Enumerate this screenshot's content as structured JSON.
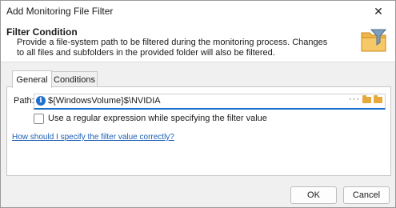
{
  "window": {
    "title": "Add Monitoring File Filter"
  },
  "header": {
    "title": "Filter Condition",
    "description": "Provide a file-system path to be filtered during the monitoring process. Changes to all files and subfolders in the provided folder will also be filtered."
  },
  "tabs": [
    {
      "label": "General"
    },
    {
      "label": "Conditions"
    }
  ],
  "path": {
    "label": "Path:",
    "value": "${WindowsVolume}$\\NVIDIA",
    "more_glyph": "···"
  },
  "regex_option": {
    "label": "Use a regular expression while specifying the filter value",
    "checked": false
  },
  "help_link": "How should I specify the filter value correctly?",
  "buttons": {
    "ok": "OK",
    "cancel": "Cancel"
  },
  "colors": {
    "accent": "#1a6fc9",
    "link": "#1a5fb4",
    "folder": "#e5a93c"
  }
}
